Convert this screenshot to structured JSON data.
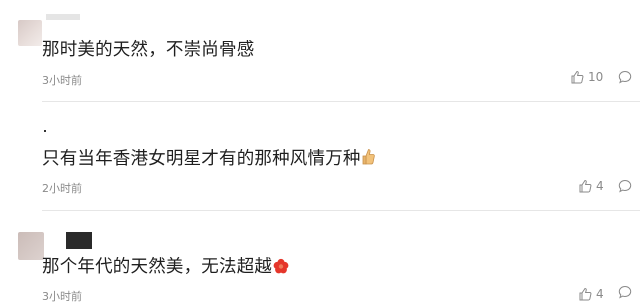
{
  "comments": [
    {
      "text": "那时美的天然，不崇尚骨感",
      "time": "3小时前",
      "likes": "10"
    },
    {
      "text": "只有当年香港女明星才有的那种风情万种",
      "time": "2小时前",
      "likes": "4",
      "emoji": "thumbs-up-emoji"
    },
    {
      "text": "那个年代的天然美，无法超越",
      "time": "3小时前",
      "likes": "4",
      "emoji": "red-flower-emoji"
    }
  ],
  "icons": {
    "like": "thumbs-up-outline-icon",
    "reply": "comment-bubble-icon"
  }
}
